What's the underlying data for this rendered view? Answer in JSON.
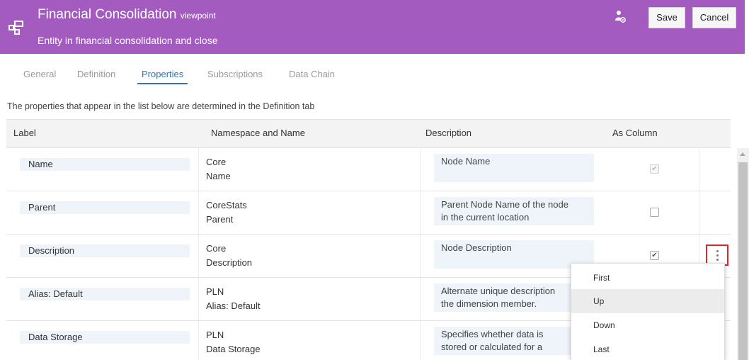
{
  "header": {
    "title": "Financial Consolidation",
    "title_suffix": "viewpoint",
    "subtitle": "Entity in financial consolidation and close",
    "save_label": "Save",
    "cancel_label": "Cancel",
    "background_color": "#a35bbf",
    "icons": {
      "app": "hierarchy-icon",
      "user": "user-settings-icon"
    }
  },
  "tabs": [
    {
      "label": "General",
      "active": false
    },
    {
      "label": "Definition",
      "active": false
    },
    {
      "label": "Properties",
      "active": true
    },
    {
      "label": "Subscriptions",
      "active": false
    },
    {
      "label": "Data Chain",
      "active": false
    }
  ],
  "intro_text": "The properties that appear in the list below are determined in the Definition tab",
  "table": {
    "columns": [
      "Label",
      "Namespace and Name",
      "Description",
      "As Column"
    ],
    "rows": [
      {
        "label": "Name",
        "namespace": "Core",
        "name": "Name",
        "description_1": "Node Name",
        "description_2": "",
        "as_column": "checked-disabled"
      },
      {
        "label": "Parent",
        "namespace": "CoreStats",
        "name": "Parent",
        "description_1": "Parent Node Name of the node",
        "description_2": "in the current location",
        "as_column": "unchecked"
      },
      {
        "label": "Description",
        "namespace": "Core",
        "name": "Description",
        "description_1": "Node Description",
        "description_2": "",
        "as_column": "checked"
      },
      {
        "label": "Alias: Default",
        "namespace": "PLN",
        "name": "Alias: Default",
        "description_1": "Alternate unique description",
        "description_2": "the dimension member.",
        "as_column": "none"
      },
      {
        "label": "Data Storage",
        "namespace": "PLN",
        "name": "Data Storage",
        "description_1": "Specifies whether data is",
        "description_2": "stored or calculated for a",
        "as_column": "none"
      }
    ]
  },
  "row_menu": {
    "items": [
      "First",
      "Up",
      "Down",
      "Last"
    ],
    "highlighted": "Up",
    "icon": "kebab-menu-icon"
  },
  "colors": {
    "accent": "#3b72a8",
    "highlight_border": "#e0242b",
    "field_bg": "#eef4fa"
  }
}
